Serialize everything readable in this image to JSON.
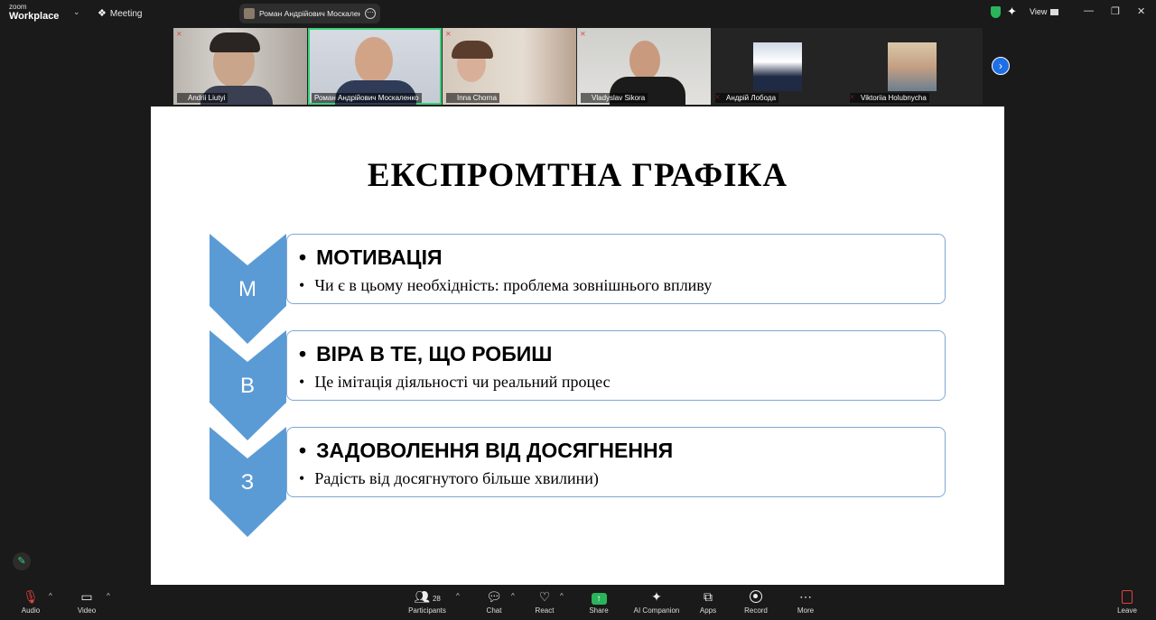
{
  "app": {
    "logo_top": "zoom",
    "logo_bottom": "Workplace",
    "meeting_label": "Meeting",
    "host_name": "Роман Андрійович Москаленко",
    "view_label": "View"
  },
  "participants_strip": [
    {
      "name": "Andrii Liutyi",
      "muted": true,
      "active": false
    },
    {
      "name": "Роман Андрійович Москаленко",
      "muted": false,
      "active": true
    },
    {
      "name": "Inna Chorna",
      "muted": true,
      "active": false
    },
    {
      "name": "Vladyslav Sikora",
      "muted": true,
      "active": false
    },
    {
      "name": "Андрій Лобода",
      "muted": true,
      "active": false
    },
    {
      "name": "Viktoriia Holubnycha",
      "muted": true,
      "active": false
    }
  ],
  "slide": {
    "title": "ЕКСПРОМТНА ГРАФІКА",
    "accent_color": "#5b9bd5",
    "items": [
      {
        "letter": "М",
        "heading": "МОТИВАЦІЯ",
        "detail": "Чи є в цьому необхідність: проблема зовнішнього впливу"
      },
      {
        "letter": "В",
        "heading": "ВІРА В ТЕ, ЩО РОБИШ",
        "detail": "Це імітація діяльності чи реальний процес"
      },
      {
        "letter": "З",
        "heading": "ЗАДОВОЛЕННЯ ВІД ДОСЯГНЕННЯ",
        "detail": "Радість від досягнутого більше хвилини)"
      }
    ],
    "bullet": "•"
  },
  "toolbar": {
    "audio": "Audio",
    "video": "Video",
    "participants": "Participants",
    "participants_count": "28",
    "chat": "Chat",
    "react": "React",
    "share": "Share",
    "ai_companion": "AI Companion",
    "apps": "Apps",
    "record": "Record",
    "more": "More",
    "leave": "Leave"
  }
}
